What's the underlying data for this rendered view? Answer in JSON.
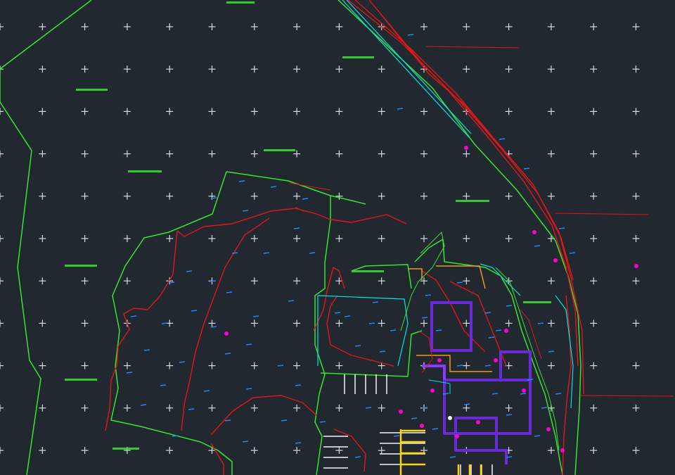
{
  "viewport": {
    "name": "cad-model-space",
    "background": "#212830",
    "grid": {
      "visible": true,
      "marker": "plus",
      "color": "#d7dbe0"
    }
  },
  "colors": {
    "boundary": "#37e52f",
    "contour": "#e21717",
    "annotation": "#1f87ff",
    "building": "#6b2ad8",
    "building_outline": "#8b3bff",
    "wall": "#ffd400",
    "utility": "#00e5e5",
    "marker": "#ff00d0",
    "white": "#f5f5f5"
  },
  "layers": [
    {
      "name": "site-boundary",
      "color": "#37e52f"
    },
    {
      "name": "contours",
      "color": "#e21717"
    },
    {
      "name": "annotations",
      "color": "#1f87ff"
    },
    {
      "name": "buildings",
      "color": "#6b2ad8"
    }
  ]
}
